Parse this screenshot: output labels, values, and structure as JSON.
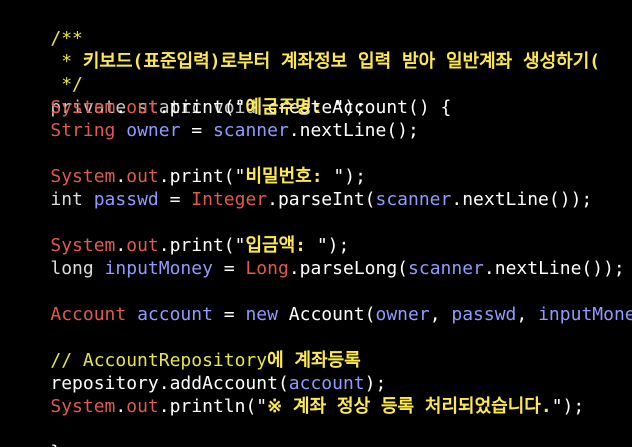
{
  "code": {
    "line1": "/**",
    "line2_prefix": " * ",
    "line2_text": "키보드(표준입력)로부터 계좌정보 입력 받아 일반계좌 생성하기(",
    "line3": " */",
    "line4": {
      "kw_private": "private",
      "kw_static": "static",
      "kw_void": "void",
      "method": "createAccount",
      "tail": "() {"
    },
    "line5": {
      "class": "System",
      "dot1": ".",
      "field": "out",
      "dot2": ".",
      "method": "print",
      "open": "(\"",
      "str": "예금주명: ",
      "close": "\");"
    },
    "line6": {
      "type": "String",
      "var": "owner",
      "eq": " = ",
      "obj": "scanner",
      "call": ".nextLine();"
    },
    "line8": {
      "class": "System",
      "dot1": ".",
      "field": "out",
      "dot2": ".",
      "method": "print",
      "open": "(\"",
      "str": "비밀번호: ",
      "close": "\");"
    },
    "line9": {
      "type": "int",
      "var": "passwd",
      "eq": " = ",
      "cls": "Integer",
      "call": ".parseInt(",
      "obj": "scanner",
      "call2": ".nextLine());"
    },
    "line11": {
      "class": "System",
      "dot1": ".",
      "field": "out",
      "dot2": ".",
      "method": "print",
      "open": "(\"",
      "str": "입금액: ",
      "close": "\");"
    },
    "line12": {
      "type": "long",
      "var": "inputMoney",
      "eq": " = ",
      "cls": "Long",
      "call": ".parseLong(",
      "obj": "scanner",
      "call2": ".nextLine());"
    },
    "line14": {
      "type": "Account",
      "var": "account",
      "eq": " = ",
      "kw_new": "new",
      "ctor": " Account(",
      "arg1": "owner",
      "sep1": ", ",
      "arg2": "passwd",
      "sep2": ", ",
      "arg3": "inputMoney",
      "close": ");"
    },
    "line16": {
      "slashes": "// AccountRepository",
      "ko": "에 계좌등록"
    },
    "line17": {
      "obj": "repository",
      "call": ".addAccount(",
      "arg": "account",
      "close": ");"
    },
    "line18": {
      "class": "System",
      "dot1": ".",
      "field": "out",
      "dot2": ".",
      "method": "println",
      "open": "(\"",
      "str": "※ 계좌 정상 등록 처리되었습니다.",
      "close": "\");"
    },
    "line19": "}"
  }
}
